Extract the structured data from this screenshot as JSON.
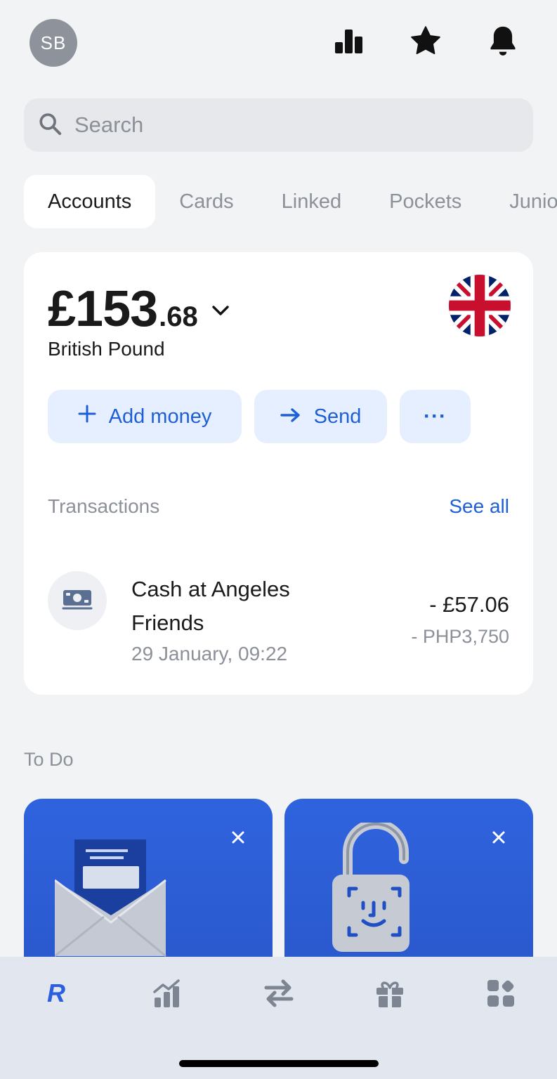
{
  "header": {
    "avatar_initials": "SB",
    "icons": [
      "stats-icon",
      "star-icon",
      "bell-icon"
    ]
  },
  "search": {
    "placeholder": "Search"
  },
  "tabs": [
    {
      "label": "Accounts",
      "active": true
    },
    {
      "label": "Cards",
      "active": false
    },
    {
      "label": "Linked",
      "active": false
    },
    {
      "label": "Pockets",
      "active": false
    },
    {
      "label": "Junior",
      "active": false
    }
  ],
  "account": {
    "balance_main": "£153",
    "balance_decimal": ".68",
    "currency_name": "British Pound",
    "flag": "uk-flag-icon"
  },
  "actions": {
    "add_money": "Add money",
    "send": "Send",
    "more": "···"
  },
  "transactions": {
    "header": "Transactions",
    "see_all": "See all",
    "items": [
      {
        "title": "Cash at Angeles Friends",
        "date": "29 January, 09:22",
        "amount": "- £57.06",
        "original_amount": "- PHP3,750",
        "icon": "cash-icon"
      }
    ]
  },
  "todo": {
    "title": "To Do",
    "cards": [
      {
        "icon": "envelope-icon"
      },
      {
        "icon": "padlock-face-id-icon"
      }
    ]
  },
  "bottom_nav": [
    "revolut-home-icon",
    "invest-icon",
    "transfer-icon",
    "rewards-icon",
    "hub-icon"
  ],
  "colors": {
    "accent": "#1f5fd6",
    "background": "#f2f3f5",
    "todo_card": "#2f63de"
  }
}
